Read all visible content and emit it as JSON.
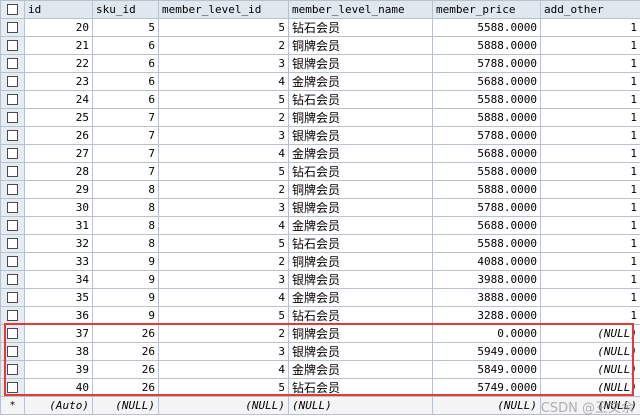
{
  "columns": [
    "id",
    "sku_id",
    "member_level_id",
    "member_level_name",
    "member_price",
    "add_other"
  ],
  "rows": [
    {
      "id": "20",
      "sku_id": "5",
      "member_level_id": "5",
      "member_level_name": "钻石会员",
      "member_price": "5588.0000",
      "add_other": "1"
    },
    {
      "id": "21",
      "sku_id": "6",
      "member_level_id": "2",
      "member_level_name": "铜牌会员",
      "member_price": "5888.0000",
      "add_other": "1"
    },
    {
      "id": "22",
      "sku_id": "6",
      "member_level_id": "3",
      "member_level_name": "银牌会员",
      "member_price": "5788.0000",
      "add_other": "1"
    },
    {
      "id": "23",
      "sku_id": "6",
      "member_level_id": "4",
      "member_level_name": "金牌会员",
      "member_price": "5688.0000",
      "add_other": "1"
    },
    {
      "id": "24",
      "sku_id": "6",
      "member_level_id": "5",
      "member_level_name": "钻石会员",
      "member_price": "5588.0000",
      "add_other": "1"
    },
    {
      "id": "25",
      "sku_id": "7",
      "member_level_id": "2",
      "member_level_name": "铜牌会员",
      "member_price": "5888.0000",
      "add_other": "1"
    },
    {
      "id": "26",
      "sku_id": "7",
      "member_level_id": "3",
      "member_level_name": "银牌会员",
      "member_price": "5788.0000",
      "add_other": "1"
    },
    {
      "id": "27",
      "sku_id": "7",
      "member_level_id": "4",
      "member_level_name": "金牌会员",
      "member_price": "5688.0000",
      "add_other": "1"
    },
    {
      "id": "28",
      "sku_id": "7",
      "member_level_id": "5",
      "member_level_name": "钻石会员",
      "member_price": "5588.0000",
      "add_other": "1"
    },
    {
      "id": "29",
      "sku_id": "8",
      "member_level_id": "2",
      "member_level_name": "铜牌会员",
      "member_price": "5888.0000",
      "add_other": "1"
    },
    {
      "id": "30",
      "sku_id": "8",
      "member_level_id": "3",
      "member_level_name": "银牌会员",
      "member_price": "5788.0000",
      "add_other": "1"
    },
    {
      "id": "31",
      "sku_id": "8",
      "member_level_id": "4",
      "member_level_name": "金牌会员",
      "member_price": "5688.0000",
      "add_other": "1"
    },
    {
      "id": "32",
      "sku_id": "8",
      "member_level_id": "5",
      "member_level_name": "钻石会员",
      "member_price": "5588.0000",
      "add_other": "1"
    },
    {
      "id": "33",
      "sku_id": "9",
      "member_level_id": "2",
      "member_level_name": "铜牌会员",
      "member_price": "4088.0000",
      "add_other": "1"
    },
    {
      "id": "34",
      "sku_id": "9",
      "member_level_id": "3",
      "member_level_name": "银牌会员",
      "member_price": "3988.0000",
      "add_other": "1"
    },
    {
      "id": "35",
      "sku_id": "9",
      "member_level_id": "4",
      "member_level_name": "金牌会员",
      "member_price": "3888.0000",
      "add_other": "1"
    },
    {
      "id": "36",
      "sku_id": "9",
      "member_level_id": "5",
      "member_level_name": "钻石会员",
      "member_price": "3288.0000",
      "add_other": "1"
    },
    {
      "id": "37",
      "sku_id": "26",
      "member_level_id": "2",
      "member_level_name": "铜牌会员",
      "member_price": "0.0000",
      "add_other": "(NULL)"
    },
    {
      "id": "38",
      "sku_id": "26",
      "member_level_id": "3",
      "member_level_name": "银牌会员",
      "member_price": "5949.0000",
      "add_other": "(NULL)"
    },
    {
      "id": "39",
      "sku_id": "26",
      "member_level_id": "4",
      "member_level_name": "金牌会员",
      "member_price": "5849.0000",
      "add_other": "(NULL)"
    },
    {
      "id": "40",
      "sku_id": "26",
      "member_level_id": "5",
      "member_level_name": "钻石会员",
      "member_price": "5749.0000",
      "add_other": "(NULL)"
    }
  ],
  "new_row": {
    "marker": "*",
    "id": "(Auto)",
    "sku_id": "(NULL)",
    "member_level_id": "(NULL)",
    "member_level_name": "(NULL)",
    "member_price": "(NULL)",
    "add_other": "(NULL)"
  },
  "watermark": "CSDN @王文余",
  "colors": {
    "header_bg": "#dfe7ef",
    "grid_line": "#b9c2cc",
    "highlight": "#e23a3a"
  }
}
